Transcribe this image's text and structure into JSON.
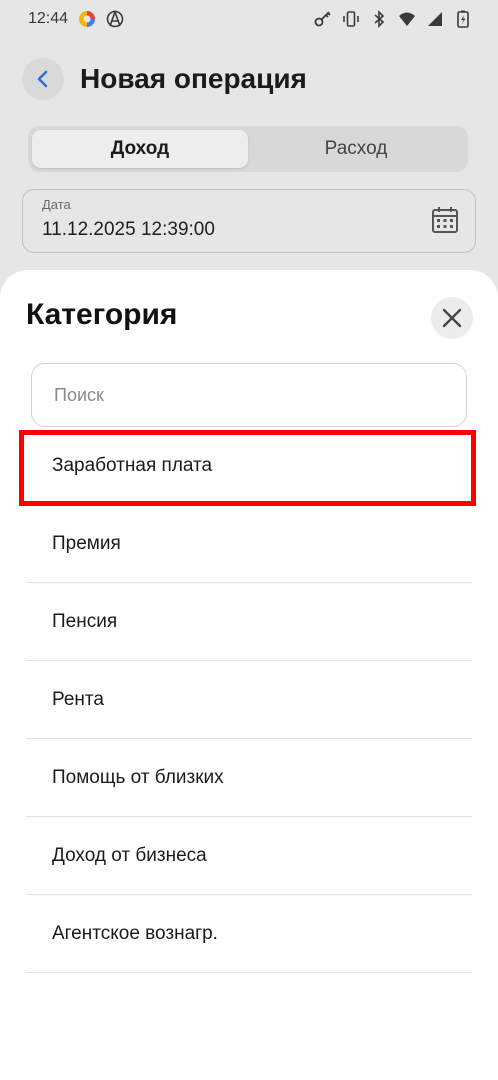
{
  "status_bar": {
    "time": "12:44",
    "icons": [
      "colorful-app-icon",
      "anarchy-icon",
      "key-icon",
      "vibrate-icon",
      "bluetooth-icon",
      "wifi-icon",
      "signal-icon",
      "battery-charging-icon"
    ]
  },
  "header": {
    "title": "Новая операция",
    "back_icon": "chevron-left-icon"
  },
  "tabs": [
    {
      "label": "Доход",
      "active": true
    },
    {
      "label": "Расход",
      "active": false
    }
  ],
  "date_field": {
    "label": "Дата",
    "value": "11.12.2025 12:39:00",
    "icon": "calendar-icon"
  },
  "sheet": {
    "title": "Категория",
    "close_icon": "close-icon",
    "search_placeholder": "Поиск",
    "items": [
      {
        "label": "Заработная плата"
      },
      {
        "label": "Премия"
      },
      {
        "label": "Пенсия"
      },
      {
        "label": "Рента"
      },
      {
        "label": "Помощь от близких"
      },
      {
        "label": "Доход от бизнеса"
      },
      {
        "label": "Агентское вознагр."
      }
    ]
  },
  "colors": {
    "highlight": "#ff0000",
    "accent": "#2f6fd6"
  }
}
